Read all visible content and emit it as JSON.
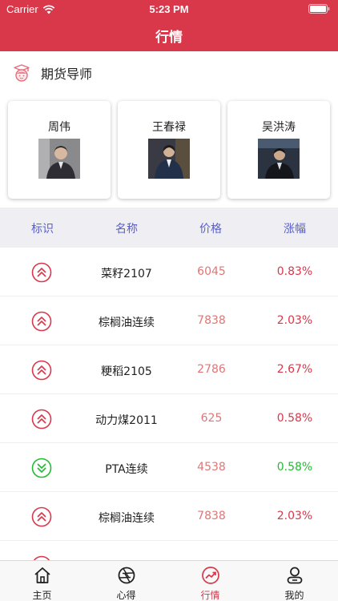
{
  "status": {
    "carrier": "Carrier",
    "time": "5:23 PM"
  },
  "nav": {
    "title": "行情"
  },
  "section": {
    "title": "期货导师",
    "icon": "teacher-icon"
  },
  "teachers": [
    {
      "name": "周伟",
      "photo_tone": "#6d6d70"
    },
    {
      "name": "王春禄",
      "photo_tone": "#3a3a44"
    },
    {
      "name": "吴洪涛",
      "photo_tone": "#2b3340"
    }
  ],
  "table": {
    "headers": {
      "mark": "标识",
      "name": "名称",
      "price": "价格",
      "change": "涨幅"
    },
    "rows": [
      {
        "trend": "up",
        "name": "菜籽2107",
        "price": "6045",
        "change": "0.83%"
      },
      {
        "trend": "up",
        "name": "棕榈油连续",
        "price": "7838",
        "change": "2.03%"
      },
      {
        "trend": "up",
        "name": "粳稻2105",
        "price": "2786",
        "change": "2.67%"
      },
      {
        "trend": "up",
        "name": "动力煤2011",
        "price": "625",
        "change": "0.58%"
      },
      {
        "trend": "down",
        "name": "PTA连续",
        "price": "4538",
        "change": "0.58%"
      },
      {
        "trend": "up",
        "name": "棕榈油连续",
        "price": "7838",
        "change": "2.03%"
      },
      {
        "trend": "up",
        "name": "",
        "price": "",
        "change": ""
      }
    ]
  },
  "tabs": [
    {
      "label": "主页",
      "icon": "home-icon",
      "active": false
    },
    {
      "label": "心得",
      "icon": "aperture-icon",
      "active": false
    },
    {
      "label": "行情",
      "icon": "trend-icon",
      "active": true
    },
    {
      "label": "我的",
      "icon": "user-icon",
      "active": false
    }
  ],
  "colors": {
    "brand": "#d9374a",
    "up": "#d9374a",
    "down": "#22bb33",
    "price": "#e27575",
    "header_text": "#5a5fc8"
  }
}
